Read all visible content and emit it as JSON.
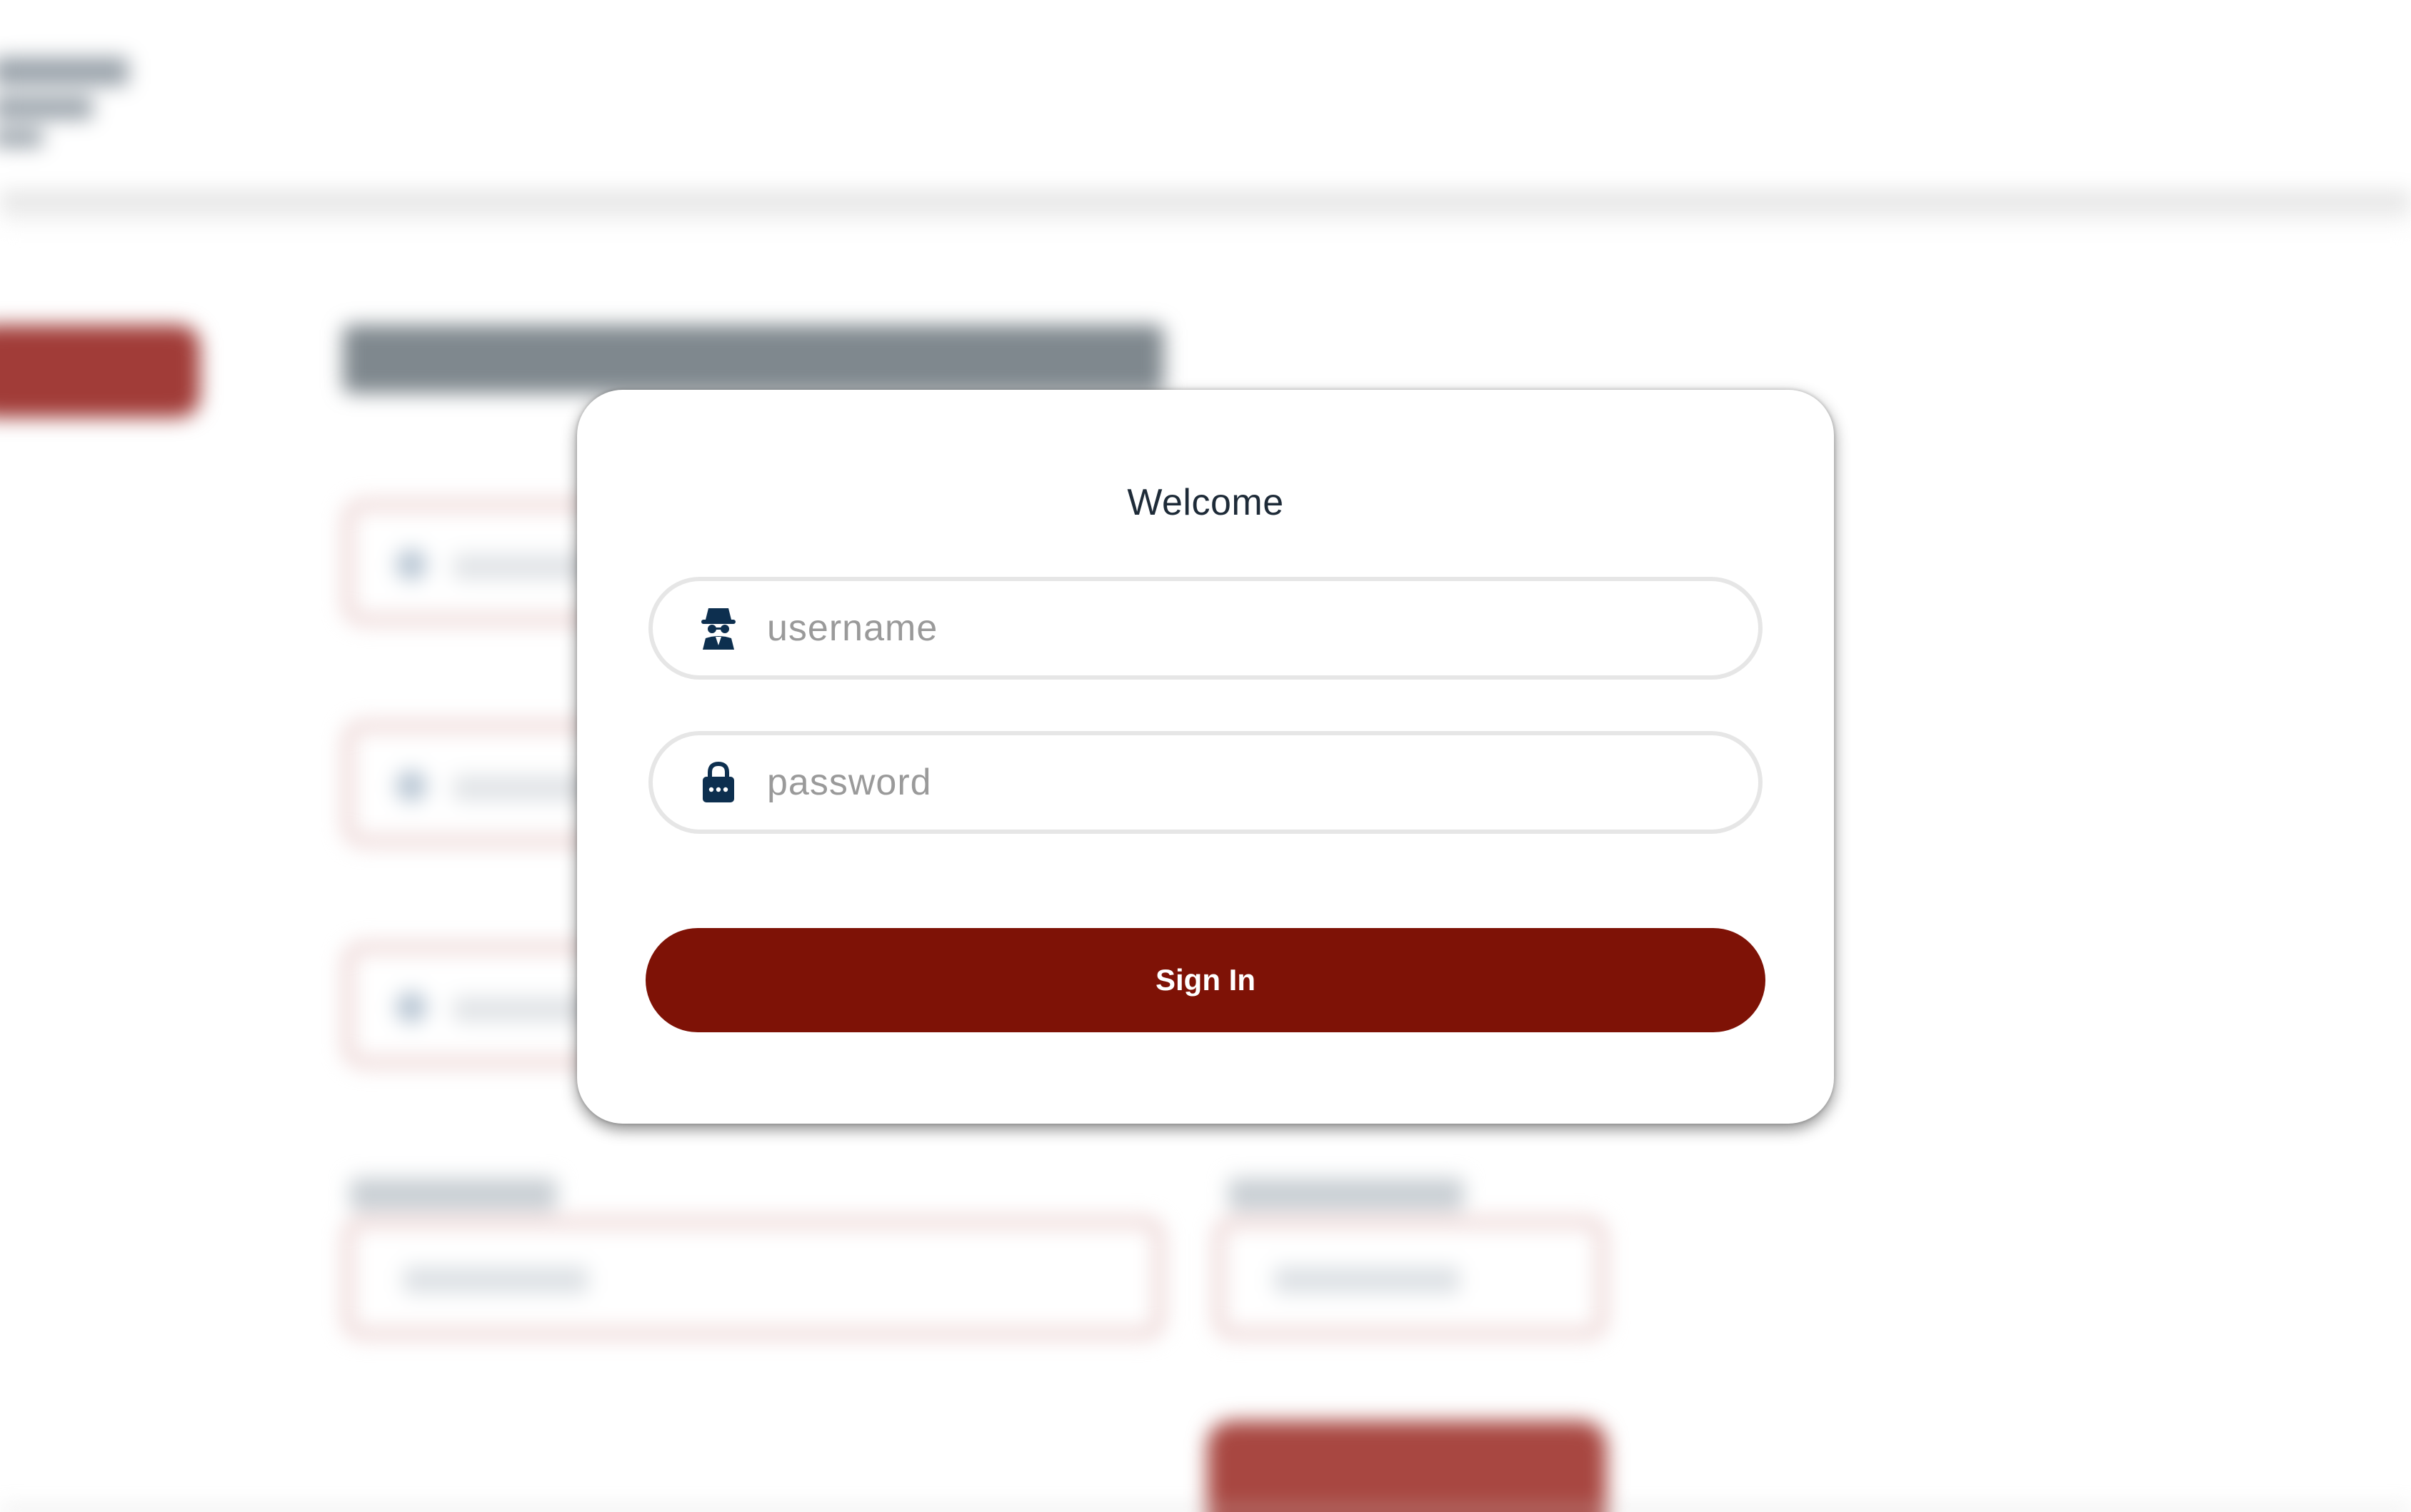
{
  "login_modal": {
    "title": "Welcome",
    "username": {
      "placeholder": "username",
      "value": "",
      "icon": "spy-user-icon"
    },
    "password": {
      "placeholder": "password",
      "value": "",
      "icon": "lock-icon"
    },
    "submit_label": "Sign In"
  },
  "colors": {
    "primary": "#7e1206",
    "title_text": "#1e2b38",
    "icon": "#0d2f4f",
    "input_border": "#e6e6e6",
    "background_accent": "#a13c38"
  }
}
